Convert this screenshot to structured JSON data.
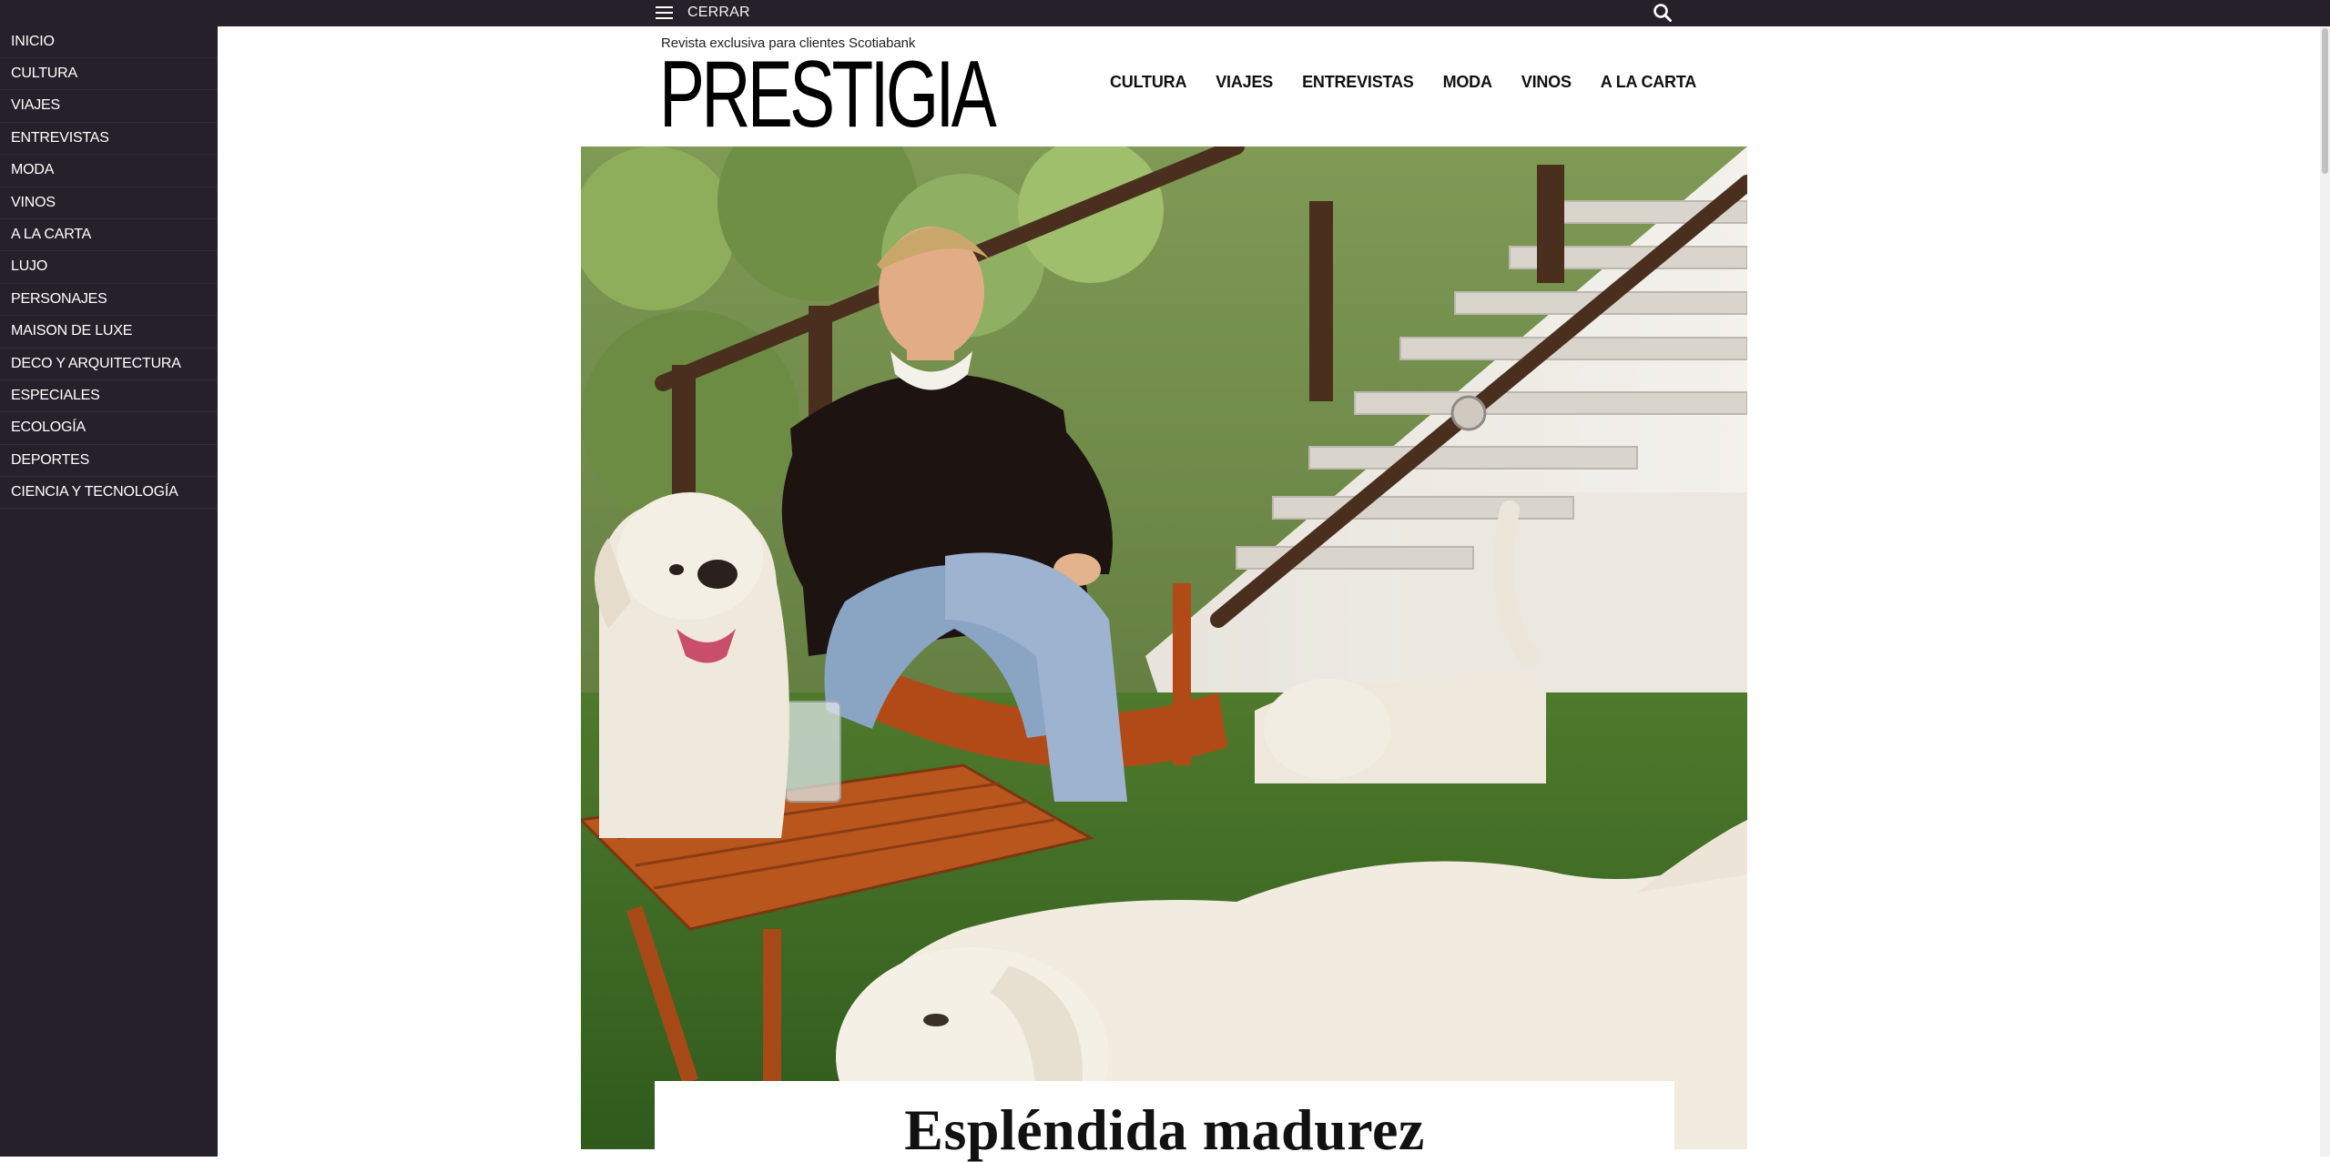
{
  "topbar": {
    "menu_label": "CERRAR",
    "menu_icon": "hamburger-icon",
    "search_icon": "search-icon"
  },
  "sidebar": {
    "items": [
      {
        "label": "INICIO"
      },
      {
        "label": "CULTURA"
      },
      {
        "label": "VIAJES"
      },
      {
        "label": "ENTREVISTAS"
      },
      {
        "label": "MODA"
      },
      {
        "label": "VINOS"
      },
      {
        "label": "A LA CARTA"
      },
      {
        "label": "LUJO"
      },
      {
        "label": "PERSONAJES"
      },
      {
        "label": "MAISON DE LUXE"
      },
      {
        "label": "DECO Y ARQUITECTURA"
      },
      {
        "label": "ESPECIALES"
      },
      {
        "label": "ECOLOGÍA"
      },
      {
        "label": "DEPORTES"
      },
      {
        "label": "CIENCIA Y TECNOLOGÍA"
      }
    ]
  },
  "header": {
    "tagline": "Revista exclusiva para clientes Scotiabank",
    "logo": "PRESTIGIA",
    "nav": [
      {
        "label": "CULTURA"
      },
      {
        "label": "VIAJES"
      },
      {
        "label": "ENTREVISTAS"
      },
      {
        "label": "MODA"
      },
      {
        "label": "VINOS"
      },
      {
        "label": "A LA CARTA"
      }
    ]
  },
  "article": {
    "headline": "Espléndida madurez"
  },
  "colors": {
    "dark_bar": "#25202a",
    "page_bg": "#ffffff",
    "text": "#111111"
  }
}
